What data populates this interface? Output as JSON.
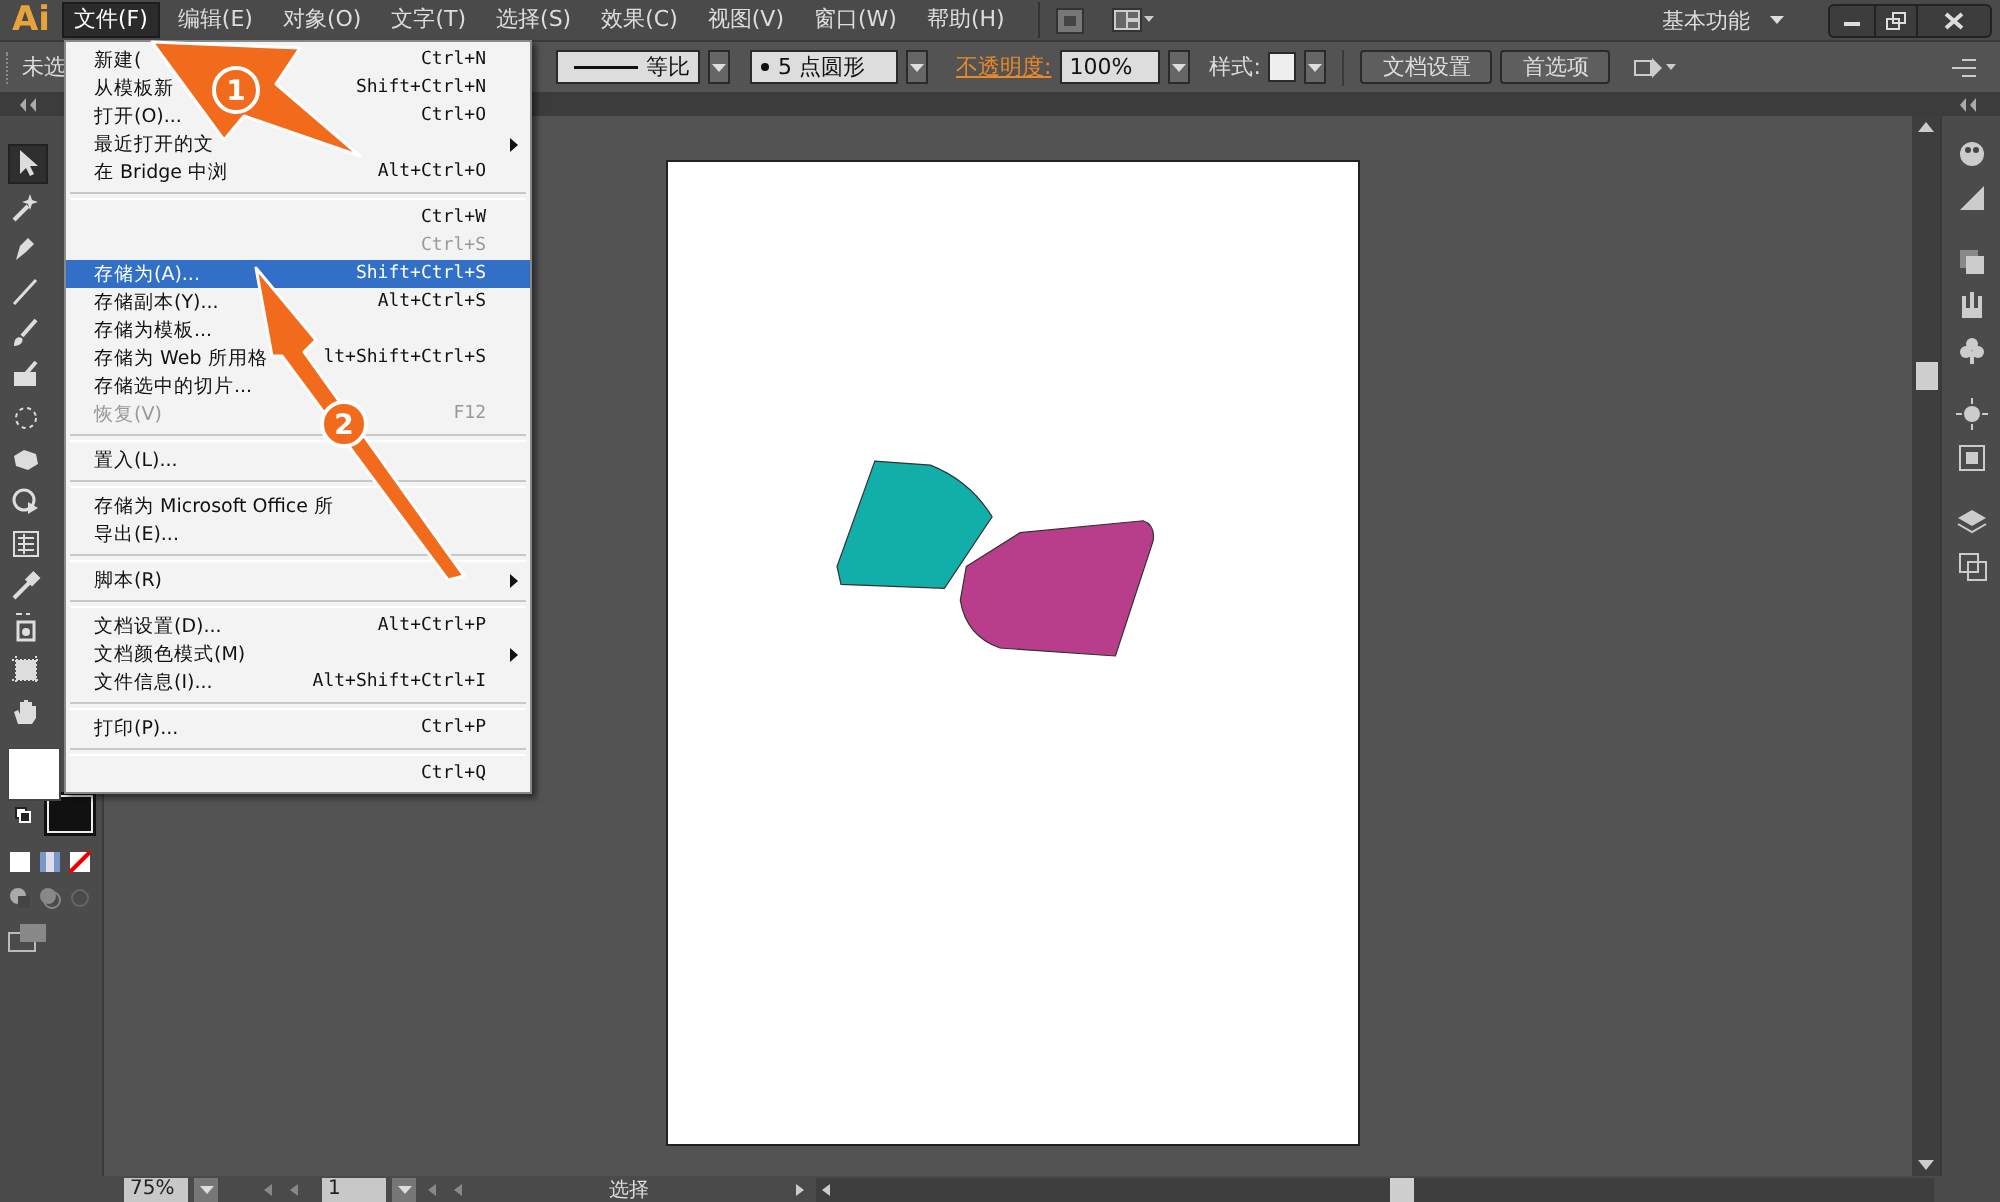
{
  "app": {
    "logo": "Ai"
  },
  "menubar": {
    "items": [
      {
        "label": "文件(F)",
        "selected": true
      },
      {
        "label": "编辑(E)",
        "selected": false
      },
      {
        "label": "对象(O)",
        "selected": false
      },
      {
        "label": "文字(T)",
        "selected": false
      },
      {
        "label": "选择(S)",
        "selected": false
      },
      {
        "label": "效果(C)",
        "selected": false
      },
      {
        "label": "视图(V)",
        "selected": false
      },
      {
        "label": "窗口(W)",
        "selected": false
      },
      {
        "label": "帮助(H)",
        "selected": false
      }
    ],
    "workspace": "基本功能"
  },
  "control_bar": {
    "selection_label": "未选",
    "stroke_profile": "等比",
    "brush": "5 点圆形",
    "opacity_label": "不透明度:",
    "opacity": "100%",
    "style_label": "样式:",
    "buttons": [
      "文档设置",
      "首选项"
    ]
  },
  "file_menu": {
    "items": [
      {
        "kind": "item",
        "label": "新建(",
        "shortcut": "Ctrl+N",
        "disabled": false,
        "selected": false,
        "submenu": false
      },
      {
        "kind": "item",
        "label": "从模板新",
        "shortcut": "Shift+Ctrl+N",
        "disabled": false,
        "selected": false,
        "submenu": false
      },
      {
        "kind": "item",
        "label": "打开(O)...",
        "shortcut": "Ctrl+O",
        "disabled": false,
        "selected": false,
        "submenu": false
      },
      {
        "kind": "item",
        "label": "最近打开的文",
        "disabled": false,
        "selected": false,
        "submenu": true
      },
      {
        "kind": "item",
        "label": "在 Bridge 中浏",
        "shortcut": "Alt+Ctrl+O",
        "disabled": false,
        "selected": false,
        "submenu": false
      },
      {
        "kind": "separator"
      },
      {
        "kind": "item",
        "shortcut": "Ctrl+W",
        "disabled": false,
        "selected": false,
        "submenu": false
      },
      {
        "kind": "item",
        "shortcut": "Ctrl+S",
        "disabled": true,
        "selected": false,
        "submenu": false
      },
      {
        "kind": "item",
        "label": "存储为(A)...",
        "shortcut": "Shift+Ctrl+S",
        "disabled": false,
        "selected": true,
        "submenu": false
      },
      {
        "kind": "item",
        "label": "存储副本(Y)...",
        "shortcut": "Alt+Ctrl+S",
        "disabled": false,
        "selected": false,
        "submenu": false
      },
      {
        "kind": "item",
        "label": "存储为模板...",
        "disabled": false,
        "selected": false,
        "submenu": false
      },
      {
        "kind": "item",
        "label": "存储为 Web 所用格",
        "shortcut": "lt+Shift+Ctrl+S",
        "disabled": false,
        "selected": false,
        "submenu": false
      },
      {
        "kind": "item",
        "label": "存储选中的切片...",
        "disabled": false,
        "selected": false,
        "submenu": false
      },
      {
        "kind": "item",
        "label": "恢复(V)",
        "shortcut": "F12",
        "disabled": true,
        "selected": false,
        "submenu": false
      },
      {
        "kind": "separator"
      },
      {
        "kind": "item",
        "label": "置入(L)...",
        "disabled": false,
        "selected": false,
        "submenu": false
      },
      {
        "kind": "separator"
      },
      {
        "kind": "item",
        "label": "存储为 Microsoft Office 所",
        "disabled": false,
        "selected": false,
        "submenu": false
      },
      {
        "kind": "item",
        "label": "导出(E)...",
        "disabled": false,
        "selected": false,
        "submenu": false
      },
      {
        "kind": "separator"
      },
      {
        "kind": "item",
        "label": "脚本(R)",
        "disabled": false,
        "selected": false,
        "submenu": true
      },
      {
        "kind": "separator"
      },
      {
        "kind": "item",
        "label": "文档设置(D)...",
        "shortcut": "Alt+Ctrl+P",
        "disabled": false,
        "selected": false,
        "submenu": false
      },
      {
        "kind": "item",
        "label": "文档颜色模式(M)",
        "disabled": false,
        "selected": false,
        "submenu": true
      },
      {
        "kind": "item",
        "label": "文件信息(I)...",
        "shortcut": "Alt+Shift+Ctrl+I",
        "disabled": false,
        "selected": false,
        "submenu": false
      },
      {
        "kind": "separator"
      },
      {
        "kind": "item",
        "label": "打印(P)...",
        "shortcut": "Ctrl+P",
        "disabled": false,
        "selected": false,
        "submenu": false
      },
      {
        "kind": "separator"
      },
      {
        "kind": "item",
        "shortcut": "Ctrl+Q",
        "disabled": false,
        "selected": false,
        "submenu": false
      }
    ]
  },
  "status_bar": {
    "zoom": "75%",
    "artboard": "1",
    "tool": "选择"
  },
  "annotations": [
    {
      "number": "1"
    },
    {
      "number": "2"
    }
  ]
}
